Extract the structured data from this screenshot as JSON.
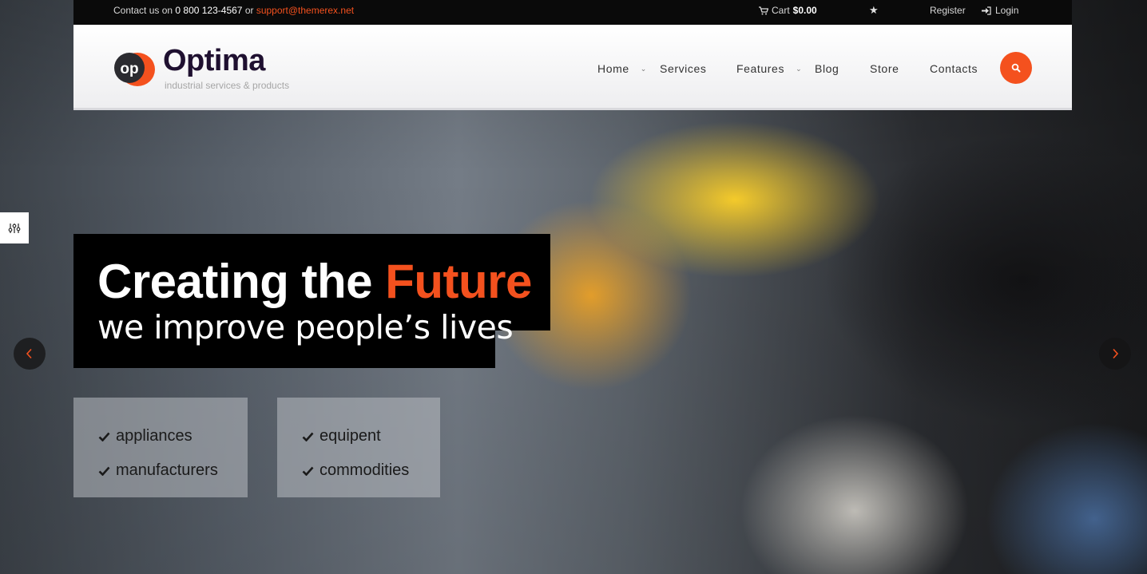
{
  "topbar": {
    "contact_prefix": "Contact us on",
    "phone": "0 800 123-4567",
    "or_text": "or",
    "email": "support@themerex.net",
    "cart_label": "Cart",
    "cart_amount": "$0.00",
    "star_icon": "star-icon",
    "register_label": "Register",
    "login_label": "Login"
  },
  "header": {
    "logo_mark_text": "op",
    "logo_title": "Optima",
    "logo_tagline": "industrial services & products",
    "nav": [
      {
        "label": "Home",
        "has_dropdown": true
      },
      {
        "label": "Services",
        "has_dropdown": false
      },
      {
        "label": "Features",
        "has_dropdown": true
      },
      {
        "label": "Blog",
        "has_dropdown": false
      },
      {
        "label": "Store",
        "has_dropdown": false
      },
      {
        "label": "Contacts",
        "has_dropdown": false
      }
    ],
    "search_icon": "search-icon"
  },
  "hero": {
    "title_part1": "Creating the",
    "title_accent": "Future",
    "subtitle": "we improve people’s lives",
    "features_left": [
      "appliances",
      "manufacturers"
    ],
    "features_right": [
      "equipent",
      "commodities"
    ]
  },
  "colors": {
    "accent": "#f4511e",
    "topbar_bg": "#0a0a0a",
    "logo_dark": "#1f1030",
    "header_bg": "#ffffff"
  }
}
